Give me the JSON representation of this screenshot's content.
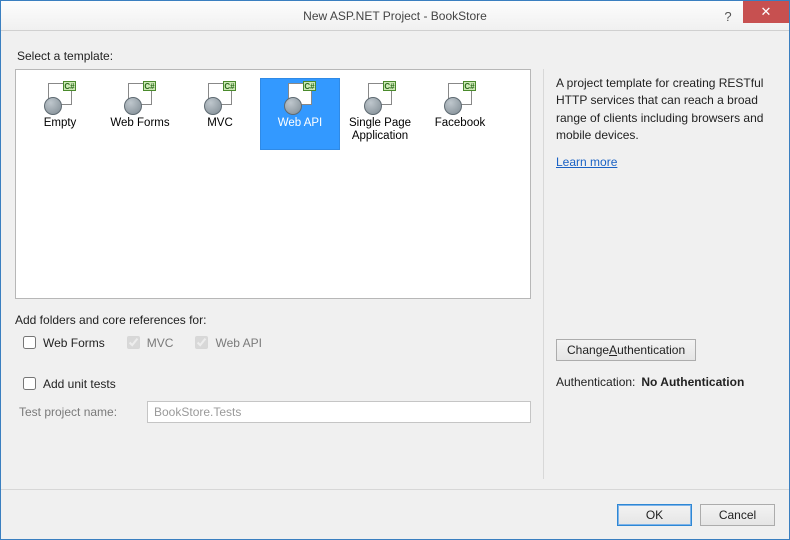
{
  "titlebar": {
    "title": "New ASP.NET Project - BookStore",
    "help_glyph": "?",
    "close_glyph": "✕"
  },
  "select_template_label": "Select a template:",
  "templates": [
    {
      "label": "Empty",
      "selected": false
    },
    {
      "label": "Web Forms",
      "selected": false
    },
    {
      "label": "MVC",
      "selected": false
    },
    {
      "label": "Web API",
      "selected": true
    },
    {
      "label": "Single Page Application",
      "selected": false
    },
    {
      "label": "Facebook",
      "selected": false
    }
  ],
  "icon_tag_text": "C#",
  "refs_label": "Add folders and core references for:",
  "refs": [
    {
      "label": "Web Forms",
      "checked": false,
      "disabled": false
    },
    {
      "label": "MVC",
      "checked": true,
      "disabled": true
    },
    {
      "label": "Web API",
      "checked": true,
      "disabled": true
    }
  ],
  "unit_tests": {
    "label": "Add unit tests",
    "checked": false
  },
  "test_project": {
    "label": "Test project name:",
    "value": "BookStore.Tests"
  },
  "description": "A project template for creating RESTful HTTP services that can reach a broad range of clients including browsers and mobile devices.",
  "learn_more_label": "Learn more",
  "change_auth_label": "Change Authentication",
  "change_auth_accesskey_index": 7,
  "auth": {
    "label": "Authentication:",
    "value": "No Authentication"
  },
  "footer": {
    "ok": "OK",
    "cancel": "Cancel"
  }
}
